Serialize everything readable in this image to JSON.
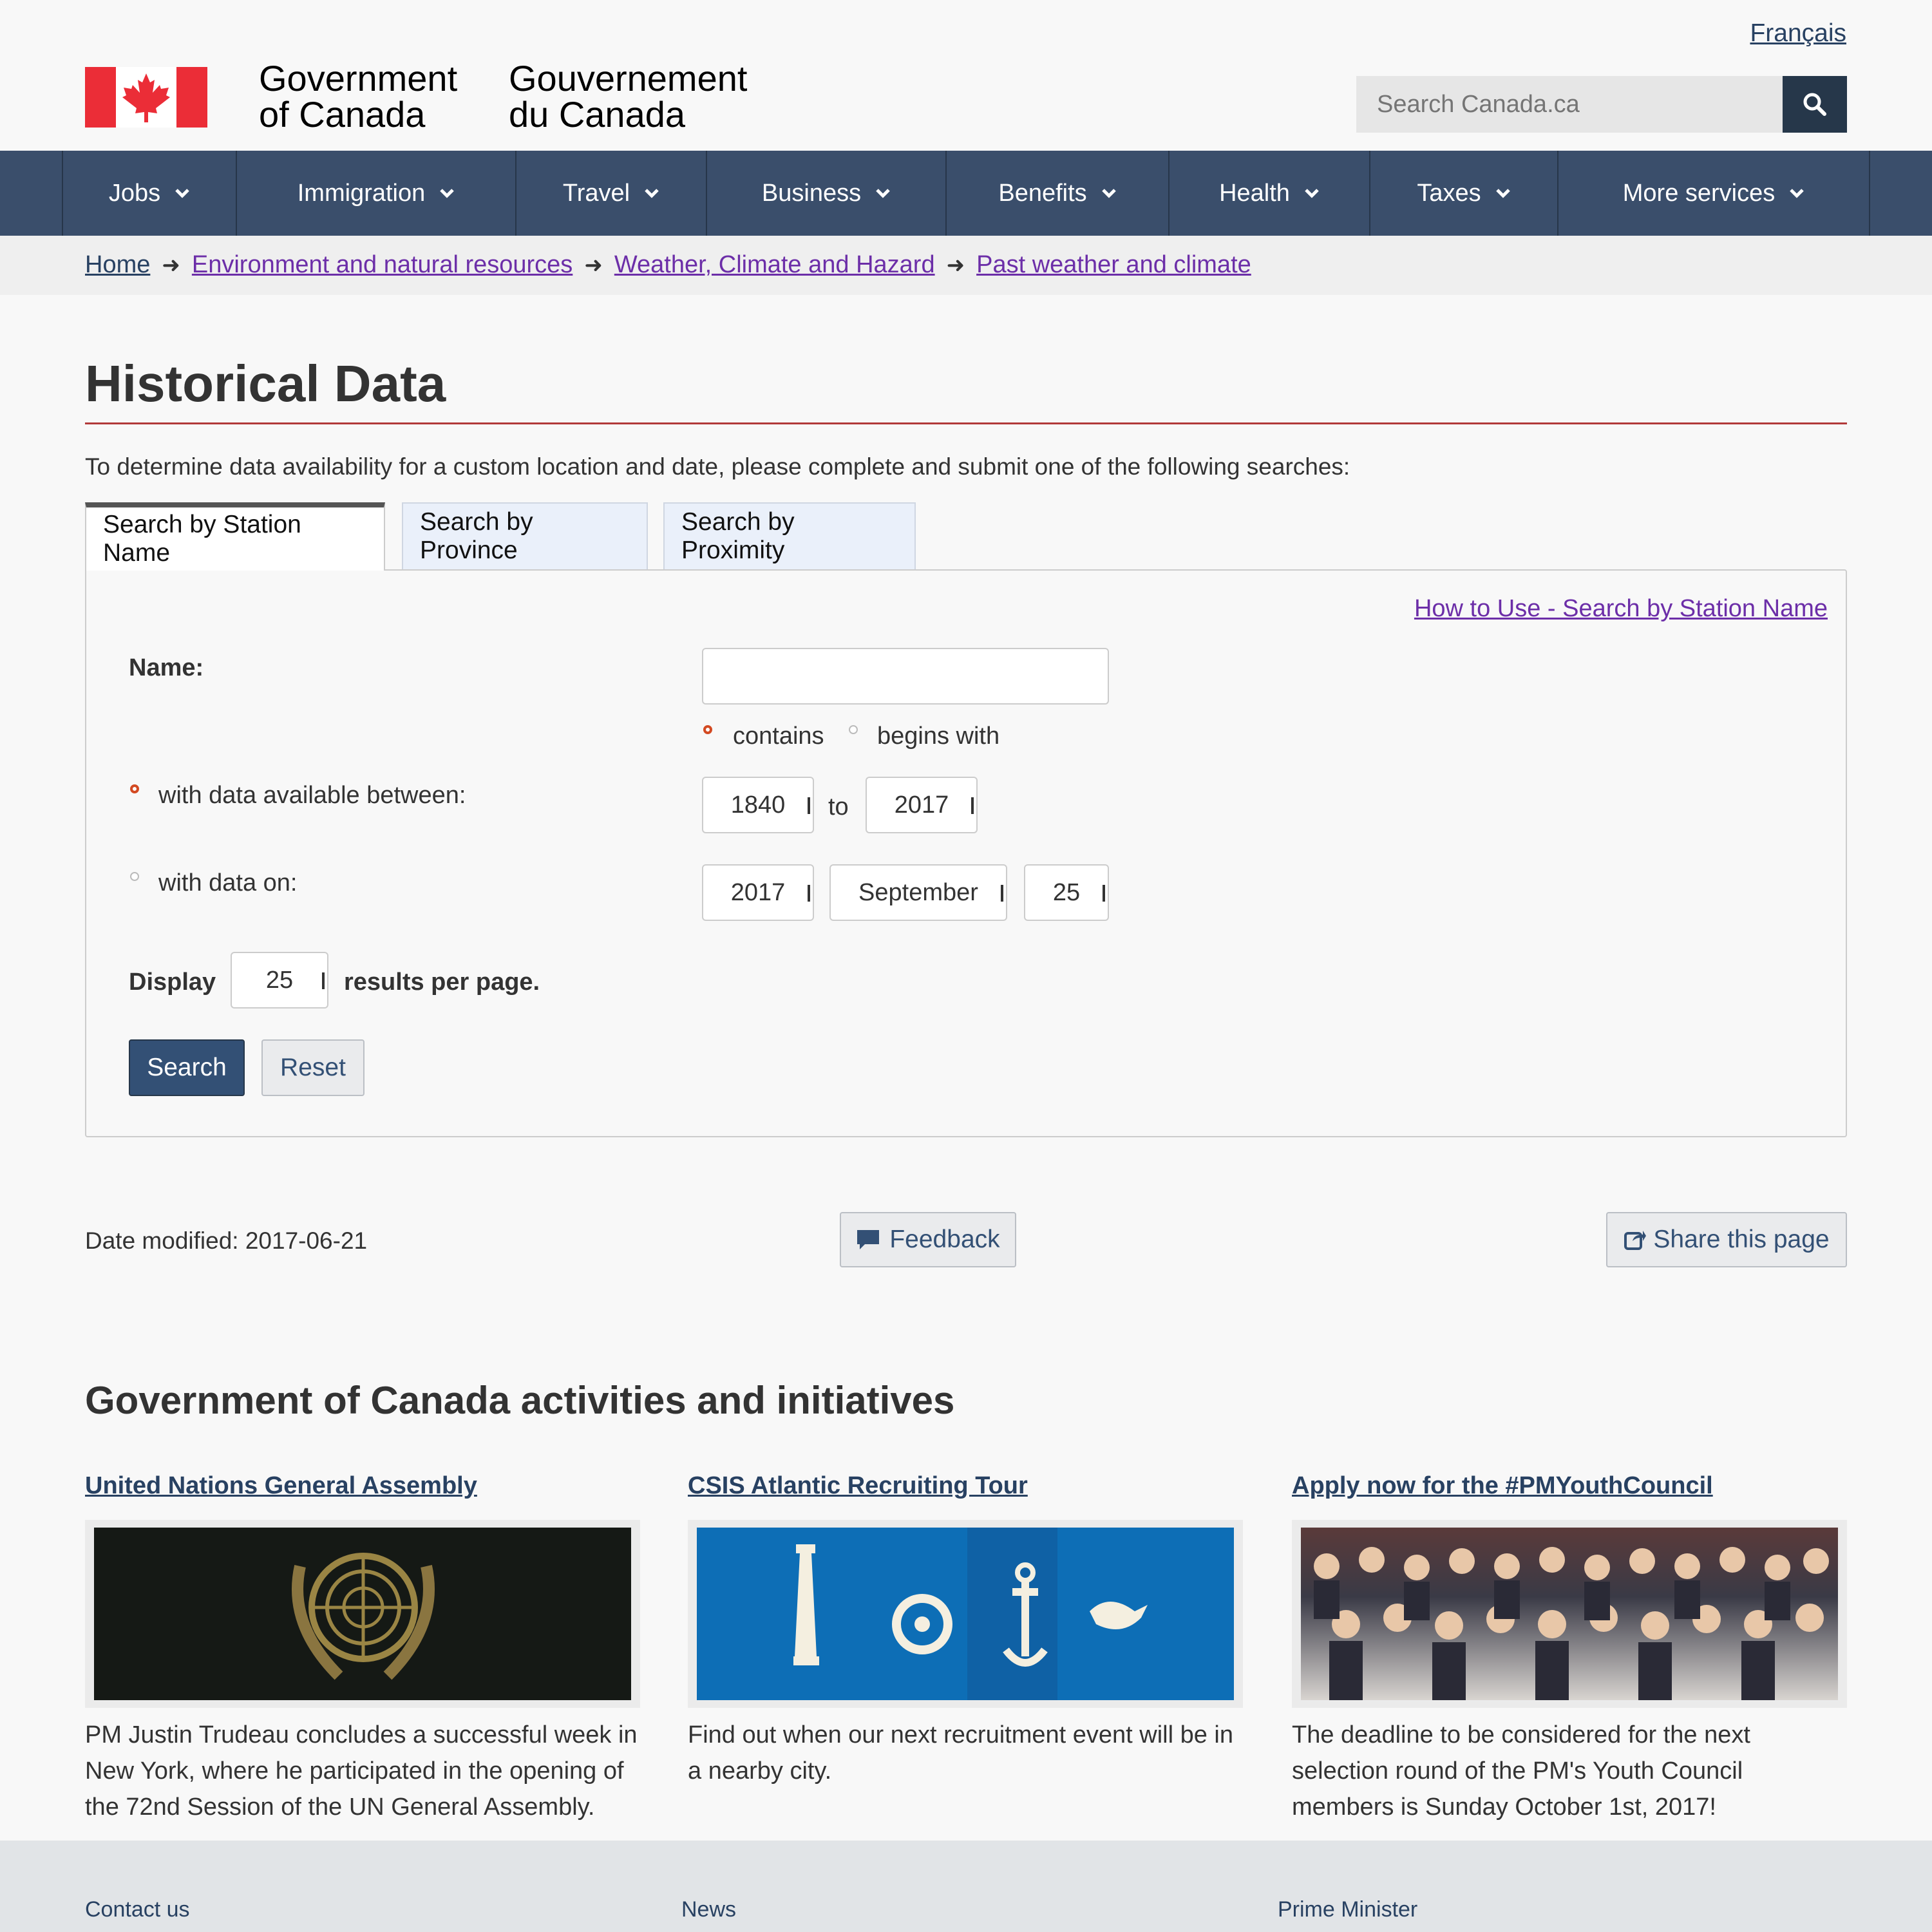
{
  "header": {
    "language_link": "Français",
    "signature_en_line1": "Government",
    "signature_en_line2": "of Canada",
    "signature_fr_line1": "Gouvernement",
    "signature_fr_line2": "du Canada",
    "search_placeholder": "Search Canada.ca"
  },
  "menu": [
    "Jobs",
    "Immigration",
    "Travel",
    "Business",
    "Benefits",
    "Health",
    "Taxes",
    "More services"
  ],
  "breadcrumb": [
    "Home",
    "Environment and natural resources",
    "Weather, Climate and Hazard",
    "Past weather and climate"
  ],
  "page": {
    "title": "Historical Data",
    "intro": "To determine data availability for a custom location and date, please complete and submit one of the following searches:"
  },
  "tabs": [
    "Search by Station Name",
    "Search by Province",
    "Search by Proximity"
  ],
  "form": {
    "howto_link": "How to Use - Search by Station Name",
    "name_label": "Name:",
    "name_value": "",
    "contains_label": "contains",
    "begins_label": "begins with",
    "between_label": "with data available between:",
    "year_from": "1840",
    "to_label": "to",
    "year_to": "2017",
    "on_label": "with data on:",
    "on_year": "2017",
    "on_month": "September",
    "on_day": "25",
    "display_label": "Display",
    "per_page": "25",
    "per_page_suffix": "results per page.",
    "search_button": "Search",
    "reset_button": "Reset"
  },
  "page_footer": {
    "date_modified": "Date modified: 2017-06-21",
    "feedback_button": "Feedback",
    "share_button": "Share this page"
  },
  "features": {
    "heading": "Government of Canada activities and initiatives",
    "items": [
      {
        "title": "United Nations General Assembly",
        "text": "PM Justin Trudeau concludes a successful week in New York, where he participated in the opening of the 72nd Session of the UN General Assembly."
      },
      {
        "title": "CSIS Atlantic Recruiting Tour",
        "text": "Find out when our next recruitment event will be in a nearby city."
      },
      {
        "title": "Apply now for the #PMYouthCouncil",
        "text": "The deadline to be considered for the next selection round of the PM's Youth Council members is Sunday October 1st, 2017!"
      }
    ]
  },
  "site_footer": [
    "Contact us",
    "News",
    "Prime Minister"
  ],
  "colors": {
    "menu_bg": "#3a4e6b",
    "brand_dark": "#26374a",
    "link_visited": "#6c2ea8",
    "accent_red": "#b23a3a"
  },
  "icons": [
    "canada-flag-icon",
    "search-icon",
    "chevron-down-icon",
    "arrow-right-icon",
    "comment-icon",
    "share-icon"
  ]
}
